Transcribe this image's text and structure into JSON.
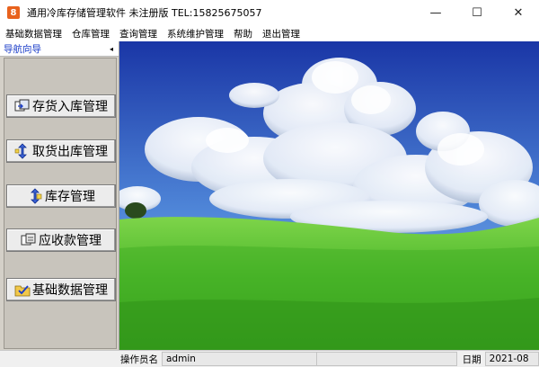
{
  "window": {
    "title": "通用冷库存储管理软件 未注册版 TEL:15825675057",
    "icon_glyph": "8",
    "minimize_glyph": "—",
    "maximize_glyph": "☐",
    "close_glyph": "✕"
  },
  "menu": {
    "items": [
      "基础数据管理",
      "仓库管理",
      "查询管理",
      "系统维护管理",
      "帮助",
      "退出管理"
    ]
  },
  "nav": {
    "header": "导航向导",
    "collapse_glyph": "◂",
    "buttons": [
      {
        "label": "存货入库管理",
        "icon": "stock-in-icon"
      },
      {
        "label": "取货出库管理",
        "icon": "stock-out-icon"
      },
      {
        "label": "库存管理",
        "icon": "inventory-icon"
      },
      {
        "label": "应收款管理",
        "icon": "receivables-icon"
      },
      {
        "label": "基础数据管理",
        "icon": "basic-data-icon"
      }
    ]
  },
  "status": {
    "operator_label": "操作员名",
    "operator_value": "admin",
    "date_label": "日期",
    "date_value": "2021-08"
  },
  "colors": {
    "nav_header_text": "#1a3cc8",
    "app_icon": "#e8621d",
    "sky_top": "#1c3ba8",
    "grass": "#4cb82a"
  }
}
